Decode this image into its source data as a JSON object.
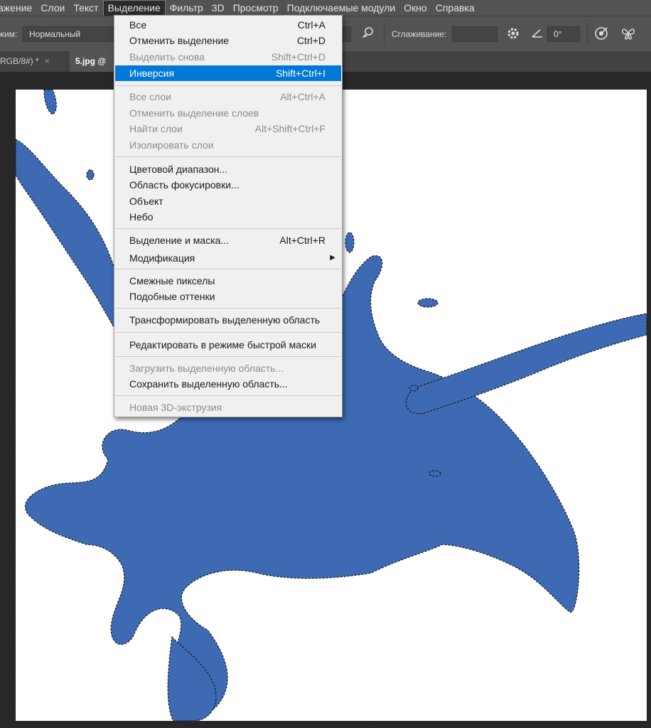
{
  "menubar": {
    "items": [
      "ажение",
      "Слои",
      "Текст",
      "Выделение",
      "Фильтр",
      "3D",
      "Просмотр",
      "Подключаемые модули",
      "Окно",
      "Справка"
    ],
    "active_index": 3
  },
  "options": {
    "mode_label": "жим:",
    "mode_value": "Нормальный",
    "smoothing_label": "Сглаживание:",
    "angle_value": "0°",
    "icons": [
      "brush-settings-icon",
      "gear-icon",
      "angle-icon",
      "target-icon",
      "butterfly-icon"
    ]
  },
  "tabs": {
    "doc1": "RGB/8#) *",
    "doc1_close": "×",
    "doc2": "5.jpg @"
  },
  "menu": {
    "items": [
      {
        "label": "Все",
        "shortcut": "Ctrl+A",
        "disabled": false
      },
      {
        "label": "Отменить выделение",
        "shortcut": "Ctrl+D",
        "disabled": false
      },
      {
        "label": "Выделить снова",
        "shortcut": "Shift+Ctrl+D",
        "disabled": true
      },
      {
        "label": "Инверсия",
        "shortcut": "Shift+Ctrl+I",
        "disabled": false,
        "highlighted": true
      },
      {
        "label": "Все слои",
        "shortcut": "Alt+Ctrl+A",
        "disabled": true
      },
      {
        "label": "Отменить выделение слоев",
        "shortcut": "",
        "disabled": true
      },
      {
        "label": "Найти слои",
        "shortcut": "Alt+Shift+Ctrl+F",
        "disabled": true
      },
      {
        "label": "Изолировать слои",
        "shortcut": "",
        "disabled": true
      },
      {
        "label": "Цветовой диапазон...",
        "shortcut": "",
        "disabled": false
      },
      {
        "label": "Область фокусировки...",
        "shortcut": "",
        "disabled": false
      },
      {
        "label": "Объект",
        "shortcut": "",
        "disabled": false
      },
      {
        "label": "Небо",
        "shortcut": "",
        "disabled": false
      },
      {
        "label": "Выделение и маска...",
        "shortcut": "Alt+Ctrl+R",
        "disabled": false
      },
      {
        "label": "Модификация",
        "shortcut": "",
        "disabled": false,
        "submenu": true
      },
      {
        "label": "Смежные пикселы",
        "shortcut": "",
        "disabled": false
      },
      {
        "label": "Подобные оттенки",
        "shortcut": "",
        "disabled": false
      },
      {
        "label": "Трансформировать выделенную область",
        "shortcut": "",
        "disabled": false
      },
      {
        "label": "Редактировать в режиме быстрой маски",
        "shortcut": "",
        "disabled": false
      },
      {
        "label": "Загрузить выделенную область...",
        "shortcut": "",
        "disabled": true
      },
      {
        "label": "Сохранить выделенную область...",
        "shortcut": "",
        "disabled": false
      },
      {
        "label": "Новая 3D-экструзия",
        "shortcut": "",
        "disabled": true
      }
    ]
  },
  "colors": {
    "splash": "#3d6ab3",
    "highlight": "#0078d7",
    "menubar": "#535353"
  }
}
